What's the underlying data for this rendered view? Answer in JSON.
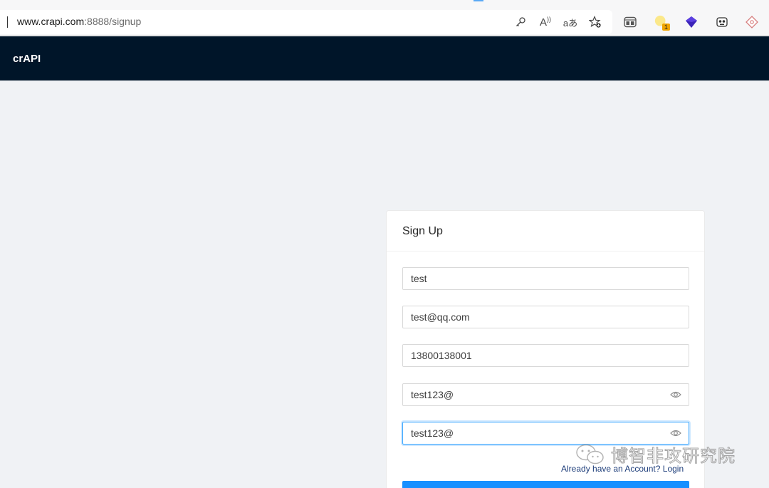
{
  "browser": {
    "url_host": "www.crapi.com",
    "url_path": ":8888/signup",
    "badge_count": "1",
    "read_aloud_glyph": "A",
    "translate_glyph": "aあ"
  },
  "app": {
    "brand": "crAPI"
  },
  "signup": {
    "title": "Sign Up",
    "name_value": "test",
    "email_value": "test@qq.com",
    "phone_value": "13800138001",
    "password_value": "test123@",
    "confirm_password_value": "test123@",
    "login_link": "Already have an Account? Login"
  },
  "watermark": {
    "text": "博智非攻研究院"
  },
  "colors": {
    "navbar": "#001529",
    "primary": "#1890ff",
    "focus": "#40a9ff"
  }
}
